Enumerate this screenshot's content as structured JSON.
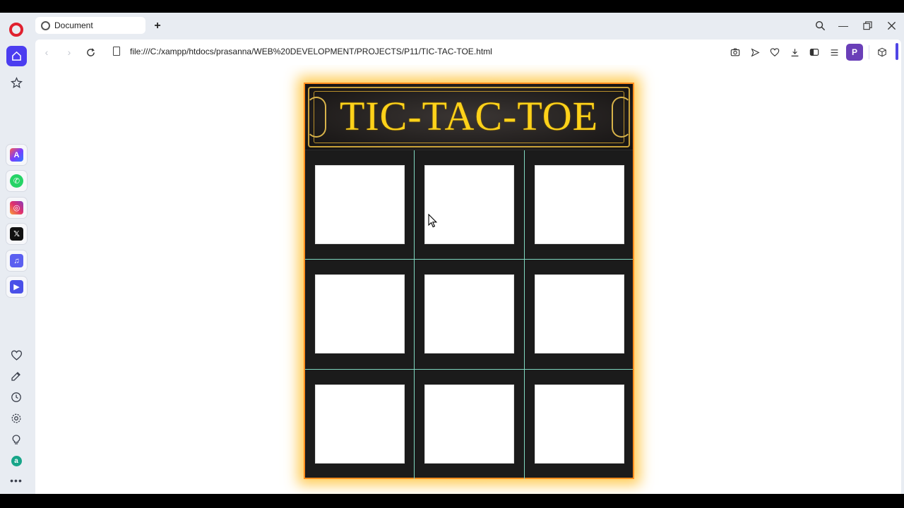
{
  "tab": {
    "title": "Document"
  },
  "address": {
    "url": "file:///C:/xampp/htdocs/prasanna/WEB%20DEVELOPMENT/PROJECTS/P11/TIC-TAC-TOE.html"
  },
  "profile": {
    "initial": "P"
  },
  "sidebar": {
    "icons": [
      "opera-logo",
      "home-icon",
      "star-icon",
      "aria-icon",
      "whatsapp-icon",
      "instagram-icon",
      "x-icon",
      "music-icon",
      "player-icon",
      "heart-icon",
      "edit-icon",
      "history-icon",
      "settings-icon",
      "bulb-icon",
      "amazon-icon",
      "more-icon"
    ]
  },
  "game": {
    "title": "TIC-TAC-TOE",
    "cells": [
      "",
      "",
      "",
      "",
      "",
      "",
      "",
      "",
      ""
    ]
  },
  "colors": {
    "title": "#ffd21a",
    "gridline": "#7fd8c0",
    "glow": "#ffd23c",
    "border": "#ff8f1f"
  }
}
